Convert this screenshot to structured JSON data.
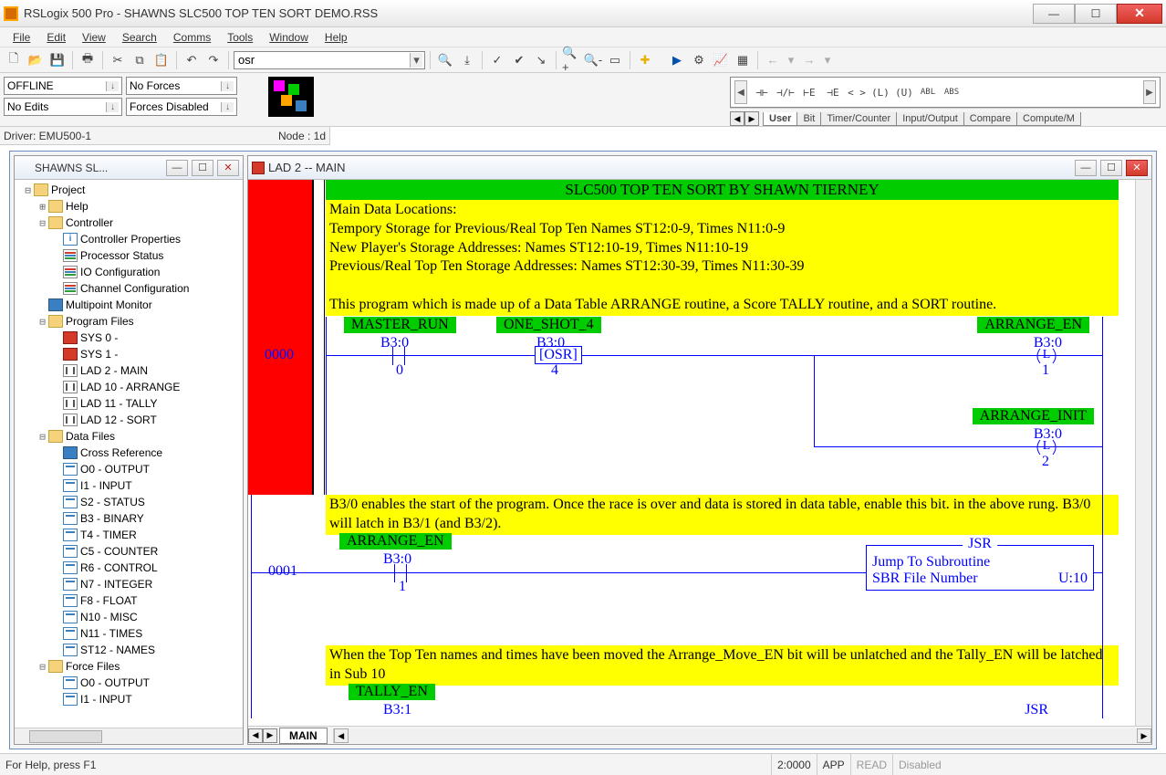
{
  "app": {
    "title": "RSLogix 500 Pro - SHAWNS SLC500 TOP TEN SORT DEMO.RSS"
  },
  "menu": [
    "File",
    "Edit",
    "View",
    "Search",
    "Comms",
    "Tools",
    "Window",
    "Help"
  ],
  "toolbar": {
    "combo_value": "osr"
  },
  "status": {
    "offline": "OFFLINE",
    "noforces": "No Forces",
    "noedits": "No Edits",
    "forcesdisabled": "Forces Disabled",
    "driver": "Driver: EMU500-1",
    "node": "Node : 1d"
  },
  "palette": {
    "tabs": [
      "User",
      "Bit",
      "Timer/Counter",
      "Input/Output",
      "Compare",
      "Compute/M"
    ],
    "glyphs": [
      "⊣⊢",
      "⊣/⊢",
      "⊢E",
      "⊣E",
      "< >",
      "(L)",
      "(U)",
      "ABL",
      "ABS"
    ]
  },
  "tree": {
    "title": "SHAWNS SL...",
    "nodes": [
      {
        "d": 0,
        "tw": "-",
        "ic": "folder",
        "label": "Project"
      },
      {
        "d": 1,
        "tw": "+",
        "ic": "folder",
        "label": "Help"
      },
      {
        "d": 1,
        "tw": "-",
        "ic": "folder",
        "label": "Controller"
      },
      {
        "d": 2,
        "tw": " ",
        "ic": "info",
        "label": "Controller Properties"
      },
      {
        "d": 2,
        "tw": " ",
        "ic": "bars",
        "label": "Processor Status"
      },
      {
        "d": 2,
        "tw": " ",
        "ic": "bars",
        "label": "IO Configuration"
      },
      {
        "d": 2,
        "tw": " ",
        "ic": "bars",
        "label": "Channel Configuration"
      },
      {
        "d": 1,
        "tw": " ",
        "ic": "blu",
        "label": "Multipoint Monitor"
      },
      {
        "d": 1,
        "tw": "-",
        "ic": "folder",
        "label": "Program Files"
      },
      {
        "d": 2,
        "tw": " ",
        "ic": "red",
        "label": "SYS 0 -"
      },
      {
        "d": 2,
        "tw": " ",
        "ic": "red",
        "label": "SYS 1 -"
      },
      {
        "d": 2,
        "tw": " ",
        "ic": "lad",
        "label": "LAD 2 - MAIN"
      },
      {
        "d": 2,
        "tw": " ",
        "ic": "lad",
        "label": "LAD 10 - ARRANGE"
      },
      {
        "d": 2,
        "tw": " ",
        "ic": "lad",
        "label": "LAD 11 - TALLY"
      },
      {
        "d": 2,
        "tw": " ",
        "ic": "lad",
        "label": "LAD 12 - SORT"
      },
      {
        "d": 1,
        "tw": "-",
        "ic": "folder",
        "label": "Data Files"
      },
      {
        "d": 2,
        "tw": " ",
        "ic": "blu",
        "label": "Cross Reference"
      },
      {
        "d": 2,
        "tw": " ",
        "ic": "page",
        "label": "O0 - OUTPUT"
      },
      {
        "d": 2,
        "tw": " ",
        "ic": "page",
        "label": "I1 - INPUT"
      },
      {
        "d": 2,
        "tw": " ",
        "ic": "page",
        "label": "S2 - STATUS"
      },
      {
        "d": 2,
        "tw": " ",
        "ic": "page",
        "label": "B3 - BINARY"
      },
      {
        "d": 2,
        "tw": " ",
        "ic": "page",
        "label": "T4 - TIMER"
      },
      {
        "d": 2,
        "tw": " ",
        "ic": "page",
        "label": "C5 - COUNTER"
      },
      {
        "d": 2,
        "tw": " ",
        "ic": "page",
        "label": "R6 - CONTROL"
      },
      {
        "d": 2,
        "tw": " ",
        "ic": "page",
        "label": "N7 - INTEGER"
      },
      {
        "d": 2,
        "tw": " ",
        "ic": "page",
        "label": "F8 - FLOAT"
      },
      {
        "d": 2,
        "tw": " ",
        "ic": "page",
        "label": "N10 - MISC"
      },
      {
        "d": 2,
        "tw": " ",
        "ic": "page",
        "label": "N11 - TIMES"
      },
      {
        "d": 2,
        "tw": " ",
        "ic": "page",
        "label": "ST12 - NAMES"
      },
      {
        "d": 1,
        "tw": "-",
        "ic": "folder",
        "label": "Force Files"
      },
      {
        "d": 2,
        "tw": " ",
        "ic": "page",
        "label": "O0 - OUTPUT"
      },
      {
        "d": 2,
        "tw": " ",
        "ic": "page",
        "label": "I1 - INPUT"
      }
    ]
  },
  "ladder": {
    "title": "LAD 2 -- MAIN",
    "tab": "MAIN",
    "header": "SLC500 TOP TEN SORT BY SHAWN TIERNEY",
    "comment0_l1": "Main Data Locations:",
    "comment0_l2": "Tempory Storage for Previous/Real Top Ten     Names ST12:0-9,     Times N11:0-9",
    "comment0_l3": "New Player's Storage Addresses:                           Names ST12:10-19, Times N11:10-19",
    "comment0_l4": "Previous/Real Top Ten Storage Addresses:         Names ST12:30-39, Times N11:30-39",
    "comment0_l5": "",
    "comment0_l6": "This program which is made up of a Data Table ARRANGE routine, a Score TALLY routine, and a SORT routine.",
    "tags": {
      "master_run": "MASTER_RUN",
      "one_shot_4": "ONE_SHOT_4",
      "arrange_en": "ARRANGE_EN",
      "arrange_init": "ARRANGE_INIT",
      "tally_en": "TALLY_EN"
    },
    "addrs": {
      "b30_0": "B3:0",
      "b30_4": "B3:0",
      "b30_1": "B3:0",
      "b30_2": "B3:0",
      "b31": "B3:1"
    },
    "bits": {
      "zero": "0",
      "four": "4",
      "one": "1",
      "two": "2"
    },
    "osr": "OSR",
    "rungnums": {
      "r0": "0000",
      "r1": "0001"
    },
    "jsr": {
      "title": "JSR",
      "line1": "Jump To Subroutine",
      "line2a": "SBR File Number",
      "line2b": "U:10"
    },
    "comment1": "B3/0 enables the start of the program. Once the race is over and data is stored in data table, enable this bit. in the above rung. B3/0 will latch in B3/1 (and B3/2).",
    "comment2": "When the Top Ten names and times have been moved the Arrange_Move_EN bit will be unlatched and the Tally_EN will be latched in Sub 10",
    "jsr2": "JSR"
  },
  "statusbar": {
    "help": "For Help, press F1",
    "pos": "2:0000",
    "app": "APP",
    "read": "READ",
    "disabled": "Disabled"
  }
}
